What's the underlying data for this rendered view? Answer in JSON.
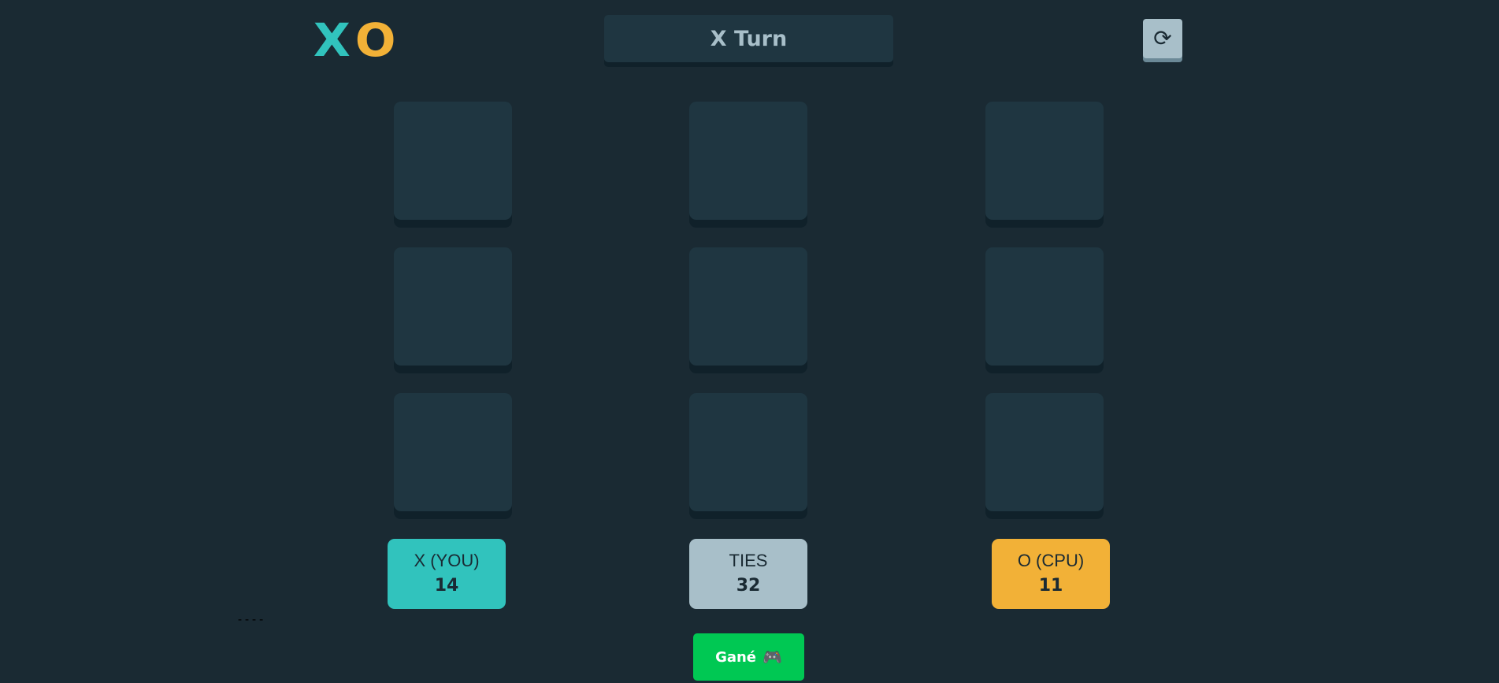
{
  "logo": {
    "x": "X",
    "o": "O"
  },
  "turn": {
    "label": "X Turn"
  },
  "restart": {
    "icon": "restart-icon",
    "glyph": "⟳"
  },
  "board": {
    "cells": [
      "",
      "",
      "",
      "",
      "",
      "",
      "",
      "",
      ""
    ]
  },
  "scores": {
    "x": {
      "label": "X (YOU)",
      "value": "14"
    },
    "ties": {
      "label": "TIES",
      "value": "32"
    },
    "o": {
      "label": "O (CPU)",
      "value": "11"
    }
  },
  "footer": {
    "dashes": "----",
    "game_button": "Gané",
    "game_icon": "🎮"
  },
  "colors": {
    "background": "#1a2a33",
    "cell": "#1f3641",
    "x_accent": "#31c3bd",
    "o_accent": "#f2b137",
    "ties": "#a8bfc9",
    "button_green": "#00c853"
  }
}
